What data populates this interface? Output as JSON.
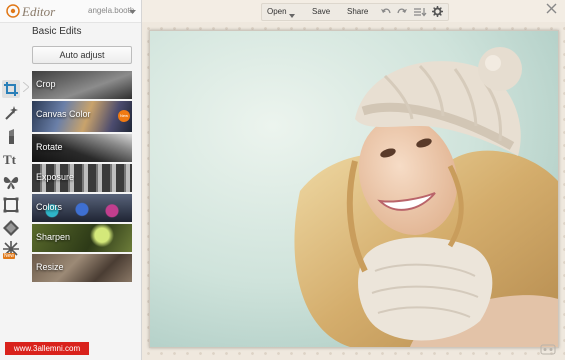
{
  "app": {
    "title": "Editor",
    "user": "angela.booth"
  },
  "panel": {
    "heading": "Basic Edits",
    "auto_adjust_label": "Auto adjust"
  },
  "edits": [
    {
      "label": "Crop"
    },
    {
      "label": "Canvas Color",
      "badge": "New"
    },
    {
      "label": "Rotate"
    },
    {
      "label": "Exposure"
    },
    {
      "label": "Colors"
    },
    {
      "label": "Sharpen"
    },
    {
      "label": "Resize"
    }
  ],
  "rail": {
    "icons": [
      "crop-icon",
      "magic-wand-icon",
      "lipstick-icon",
      "text-icon",
      "butterfly-icon",
      "frame-icon",
      "texture-icon",
      "seasonal-icon"
    ],
    "new_badge": "New"
  },
  "toolbar": {
    "open_label": "Open",
    "save_label": "Save",
    "share_label": "Share",
    "icons": [
      "undo-icon",
      "redo-icon",
      "history-icon",
      "settings-icon"
    ]
  },
  "watermark": "www.3allemni.com",
  "colors": {
    "accent_orange": "#f07a12",
    "watermark_red": "#d9221c"
  }
}
